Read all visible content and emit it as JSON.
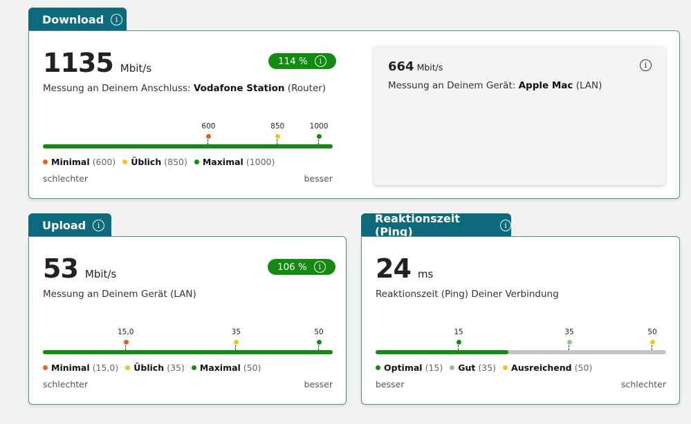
{
  "download": {
    "title": "Download",
    "value": "1135",
    "unit": "Mbit/s",
    "percent": "114 %",
    "subtitle_prefix": "Messung an Deinem Anschluss: ",
    "subtitle_bold": "Vodafone Station",
    "subtitle_suffix": " (Router)",
    "markers": [
      {
        "value": 600,
        "label": "600",
        "name": "Minimal",
        "paren": "(600)",
        "color": "#e0631a"
      },
      {
        "value": 850,
        "label": "850",
        "name": "Üblich",
        "paren": "(850)",
        "color": "#f2c51c"
      },
      {
        "value": 1000,
        "label": "1000",
        "name": "Maximal",
        "paren": "(1000)",
        "color": "#138a10"
      }
    ],
    "measured": 1135,
    "left_label": "schlechter",
    "right_label": "besser",
    "device": {
      "value": "664",
      "unit": "Mbit/s",
      "subtitle_prefix": "Messung an Deinem Gerät: ",
      "subtitle_bold": "Apple Mac",
      "subtitle_suffix": " (LAN)"
    }
  },
  "upload": {
    "title": "Upload",
    "value": "53",
    "unit": "Mbit/s",
    "percent": "106 %",
    "subtitle": "Messung an Deinem Gerät (LAN)",
    "markers": [
      {
        "value": 15,
        "label": "15,0",
        "name": "Minimal",
        "paren": "(15,0)",
        "color": "#e0631a"
      },
      {
        "value": 35,
        "label": "35",
        "name": "Üblich",
        "paren": "(35)",
        "color": "#f2c51c"
      },
      {
        "value": 50,
        "label": "50",
        "name": "Maximal",
        "paren": "(50)",
        "color": "#138a10"
      }
    ],
    "measured": 53,
    "left_label": "schlechter",
    "right_label": "besser"
  },
  "ping": {
    "title": "Reaktionszeit (Ping)",
    "value": "24",
    "unit": "ms",
    "subtitle": "Reaktionszeit (Ping) Deiner Verbindung",
    "markers": [
      {
        "value": 15,
        "label": "15",
        "name": "Optimal",
        "paren": "(15)",
        "color": "#138a10"
      },
      {
        "value": 35,
        "label": "35",
        "name": "Gut",
        "paren": "(35)",
        "color": "#8cc78e"
      },
      {
        "value": 50,
        "label": "50",
        "name": "Ausreichend",
        "paren": "(50)",
        "color": "#f2c51c"
      }
    ],
    "measured": 24,
    "left_label": "besser",
    "right_label": "schlechter"
  },
  "info_icon": "i"
}
